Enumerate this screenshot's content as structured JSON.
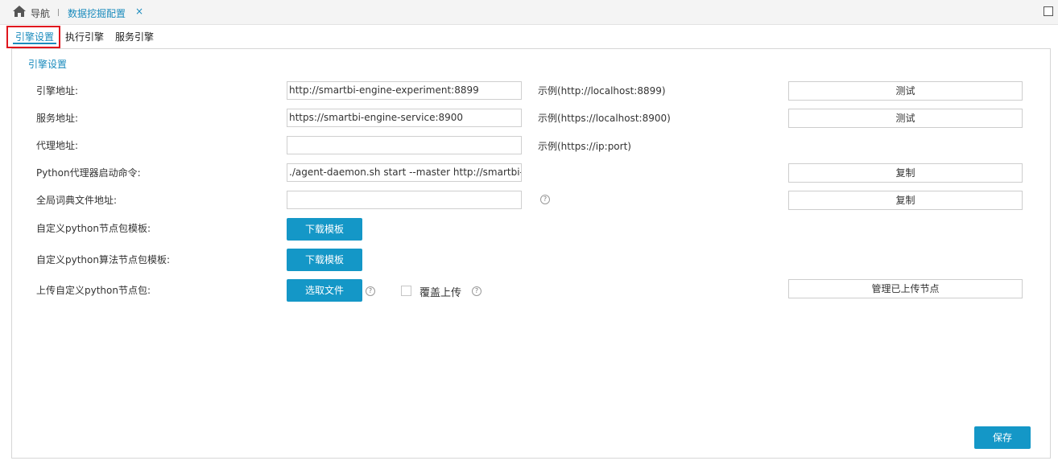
{
  "topbar": {
    "nav_label": "导航",
    "active_tab": "数据挖掘配置",
    "close": "×"
  },
  "subtabs": [
    {
      "label": "引擎设置",
      "active": true
    },
    {
      "label": "执行引擎",
      "active": false
    },
    {
      "label": "服务引擎",
      "active": false
    }
  ],
  "panel": {
    "title": "引擎设置",
    "rows": {
      "engine_address": {
        "label": "引擎地址:",
        "value": "http://smartbi-engine-experiment:8899",
        "example": "示例(http://localhost:8899)",
        "button": "测试"
      },
      "service_address": {
        "label": "服务地址:",
        "value": "https://smartbi-engine-service:8900",
        "example": "示例(https://localhost:8900)",
        "button": "测试"
      },
      "proxy_address": {
        "label": "代理地址:",
        "value": "",
        "example": "示例(https://ip:port)"
      },
      "python_agent_cmd": {
        "label": "Python代理器启动命令:",
        "value": "./agent-daemon.sh start --master http://smartbi-en",
        "button": "复制"
      },
      "global_dict": {
        "label": "全局词典文件地址:",
        "value": "",
        "button": "复制"
      },
      "custom_node_tpl": {
        "label": "自定义python节点包模板:",
        "button": "下载模板"
      },
      "custom_algo_tpl": {
        "label": "自定义python算法节点包模板:",
        "button": "下载模板"
      },
      "upload_node": {
        "label": "上传自定义python节点包:",
        "button": "选取文件",
        "overwrite_label": "覆盖上传",
        "manage_button": "管理已上传节点"
      }
    },
    "save_button": "保存"
  },
  "colors": {
    "accent": "#1497c7",
    "link": "#1a8bbd",
    "highlight_border": "#e0161e"
  }
}
